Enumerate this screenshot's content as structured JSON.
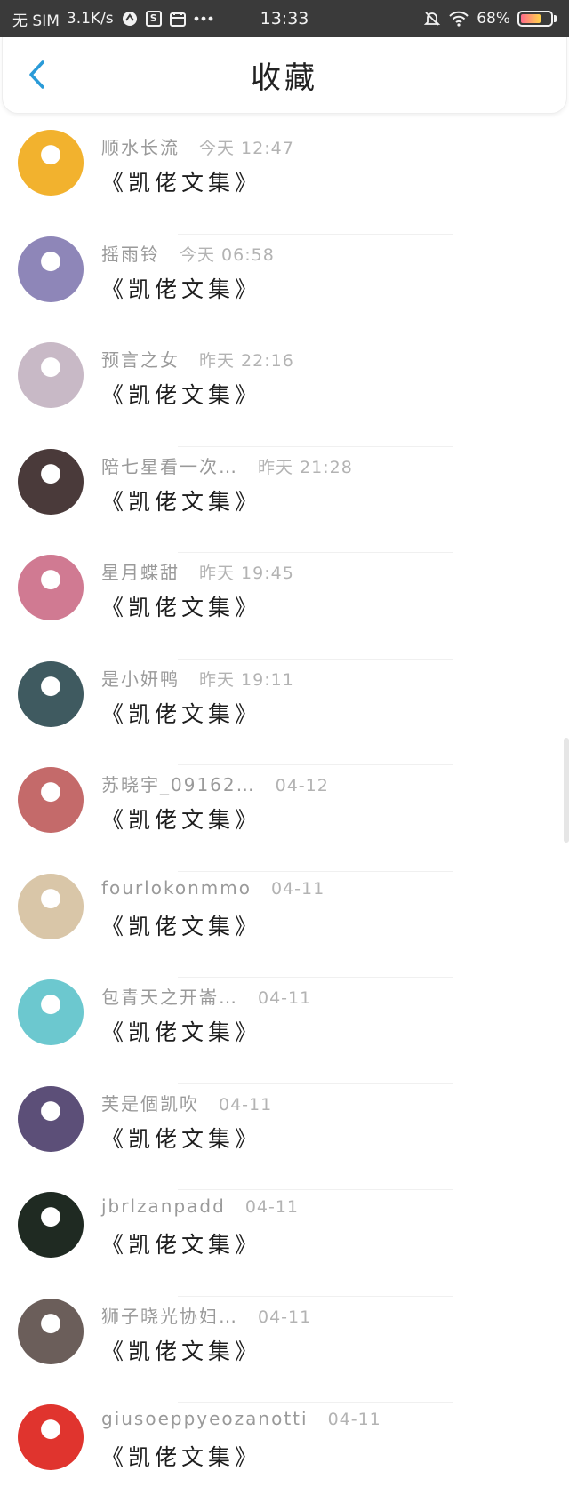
{
  "status_bar": {
    "carrier": "无 SIM",
    "speed": "3.1K/s",
    "time": "13:33",
    "battery": "68%",
    "battery_level": 0.68
  },
  "header": {
    "title": "收藏"
  },
  "items": [
    {
      "name": "顺水长流",
      "time": "今天 12:47",
      "title": "《凯佬文集》",
      "avatar_color": "#f2b22e"
    },
    {
      "name": "摇雨铃",
      "time": "今天 06:58",
      "title": "《凯佬文集》",
      "avatar_color": "#8e86b8"
    },
    {
      "name": "预言之女",
      "time": "昨天 22:16",
      "title": "《凯佬文集》",
      "avatar_color": "#c8b9c6"
    },
    {
      "name": "陪七星看一次…",
      "time": "昨天 21:28",
      "title": "《凯佬文集》",
      "avatar_color": "#4a3a3a"
    },
    {
      "name": "星月蝶甜",
      "time": "昨天 19:45",
      "title": "《凯佬文集》",
      "avatar_color": "#d07a92"
    },
    {
      "name": "是小妍鸭",
      "time": "昨天 19:11",
      "title": "《凯佬文集》",
      "avatar_color": "#3f5a60"
    },
    {
      "name": "苏晓宇_09162…",
      "time": "04-12",
      "title": "《凯佬文集》",
      "avatar_color": "#c46a6a"
    },
    {
      "name": "fourlokonmmo",
      "time": "04-11",
      "title": "《凯佬文集》",
      "avatar_color": "#d9c6a8"
    },
    {
      "name": "包青天之开崙…",
      "time": "04-11",
      "title": "《凯佬文集》",
      "avatar_color": "#6cc8cf"
    },
    {
      "name": "芙是個凯吹",
      "time": "04-11",
      "title": "《凯佬文集》",
      "avatar_color": "#5c4f78"
    },
    {
      "name": "jbrlzanpadd",
      "time": "04-11",
      "title": "《凯佬文集》",
      "avatar_color": "#1f2a22"
    },
    {
      "name": "狮子晓光协妇…",
      "time": "04-11",
      "title": "《凯佬文集》",
      "avatar_color": "#6b5e5a"
    },
    {
      "name": "giusoeppyeozanotti",
      "time": "04-11",
      "title": "《凯佬文集》",
      "avatar_color": "#e0342e"
    }
  ]
}
